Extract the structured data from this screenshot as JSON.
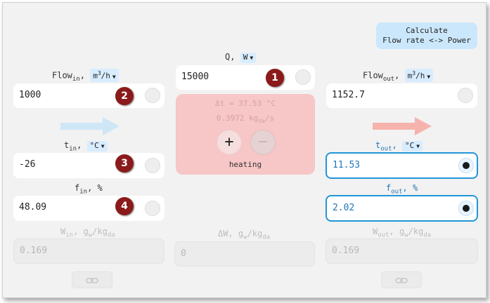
{
  "calc_button": {
    "line1": "Calculate",
    "line2": "Flow rate <-> Power"
  },
  "power": {
    "label": "Q,",
    "unit": "W",
    "value": "15000"
  },
  "flow_in": {
    "label": "Flow",
    "sub": "in",
    "sep": ",",
    "unit": "m3/h",
    "value": "1000"
  },
  "flow_out": {
    "label": "Flow",
    "sub": "out",
    "sep": ",",
    "unit": "m3/h",
    "value": "1152.7"
  },
  "t_in": {
    "label": "t",
    "sub": "in",
    "sep": ",",
    "unit": "°C",
    "value": "-26"
  },
  "t_out": {
    "label": "t",
    "sub": "out",
    "sep": ",",
    "unit": "°C",
    "value": "11.53"
  },
  "f_in": {
    "label": "f",
    "sub": "in",
    "sep": ",",
    "unit": "%",
    "value": "48.09"
  },
  "f_out": {
    "label": "f",
    "sub": "out",
    "sep": ",",
    "unit": "%",
    "value": "2.02"
  },
  "w_in": {
    "label": "W",
    "sub": "in",
    "sep": ",",
    "unit": "g",
    "unit_sub": "w",
    "unit_tail": "/kg",
    "unit_tail_sub": "da",
    "value": "0.169"
  },
  "w_out": {
    "label": "W",
    "sub": "out",
    "sep": ",",
    "unit": "g",
    "unit_sub": "w",
    "unit_tail": "/kg",
    "unit_tail_sub": "da",
    "value": "0.169"
  },
  "delta_w": {
    "label": "ΔW,",
    "unit": "g",
    "unit_sub": "w",
    "unit_tail": "/kg",
    "unit_tail_sub": "da",
    "value": "0"
  },
  "process": {
    "delta_t": "Δt = 37.53 °C",
    "mass_flow": "0.3972 kg",
    "mass_flow_sub": "da",
    "mass_flow_tail": "/s",
    "plus": "+",
    "minus": "−",
    "mode": "heating"
  },
  "badges": [
    "1",
    "2",
    "3",
    "4"
  ],
  "colors": {
    "accent": "#2196d8",
    "heating_bg": "#f7c6c6",
    "badge": "#8b1a1a",
    "arrow_in": "#cfe6f7",
    "arrow_out": "#f6b3ad"
  },
  "icons": {
    "link": "link-icon",
    "arrow_in": "arrow-right-icon",
    "arrow_out": "arrow-right-icon"
  }
}
